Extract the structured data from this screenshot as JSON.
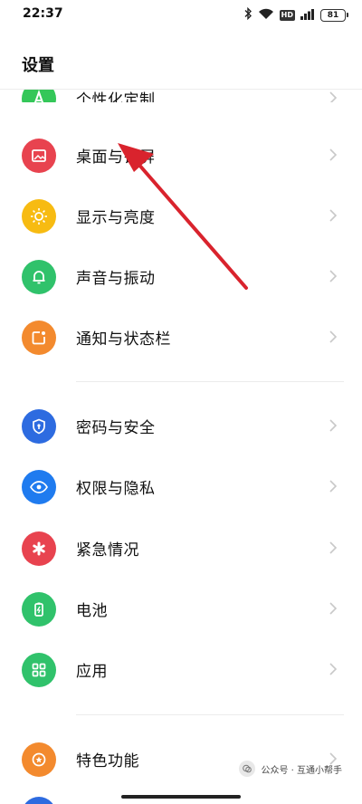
{
  "status_bar": {
    "time": "22:37",
    "battery": "81",
    "hd": "HD"
  },
  "page_title": "设置",
  "items": [
    {
      "label": "个性化定制",
      "icon": "palette-icon",
      "color": "#34c759"
    },
    {
      "label": "桌面与锁屏",
      "icon": "image-icon",
      "color": "#e8434f"
    },
    {
      "label": "显示与亮度",
      "icon": "sun-icon",
      "color": "#f7bb12"
    },
    {
      "label": "声音与振动",
      "icon": "bell-icon",
      "color": "#30c26b"
    },
    {
      "label": "通知与状态栏",
      "icon": "notification-icon",
      "color": "#f38a2e"
    },
    {
      "label": "密码与安全",
      "icon": "shield-icon",
      "color": "#2d6be0"
    },
    {
      "label": "权限与隐私",
      "icon": "eye-icon",
      "color": "#1f7bef"
    },
    {
      "label": "紧急情况",
      "icon": "asterisk-icon",
      "color": "#e8434f"
    },
    {
      "label": "电池",
      "icon": "battery-icon",
      "color": "#30c26b"
    },
    {
      "label": "应用",
      "icon": "apps-icon",
      "color": "#30c26b"
    },
    {
      "label": "特色功能",
      "icon": "star-icon",
      "color": "#f38a2e"
    }
  ],
  "annotation_color": "#d9232d",
  "watermark": {
    "text": "公众号 · 互通小帮手"
  }
}
